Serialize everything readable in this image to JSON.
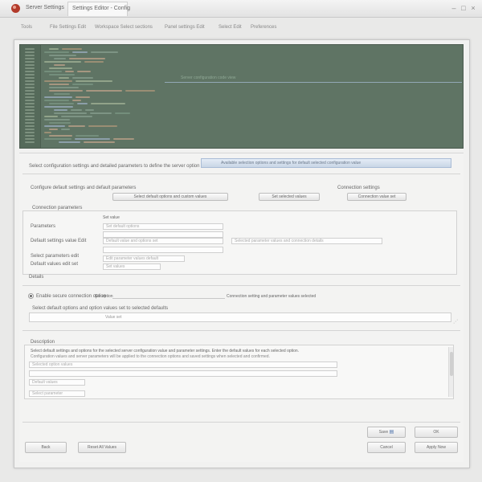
{
  "window": {
    "title": "Server Settings",
    "tab_label": "Settings Editor - Config",
    "controls": {
      "minimize": "–",
      "maximize": "□",
      "close": "×"
    }
  },
  "menu": [
    "Tools",
    "File Settings Edit",
    "Workspace Select sections",
    "Panel settings Edit",
    "Select Edit",
    "Preferences"
  ],
  "editor": {
    "header": "Server configuration code view"
  },
  "form": {
    "intro_label": "Select configuration settings and detailed parameters to define the server option",
    "highlight_value": "Available selection options and settings for default selected configuration value",
    "section1": {
      "label": "Configure default settings and default parameters",
      "button_a": "Select default options and custom values",
      "button_b": "Set selected values",
      "right_label": "Connection settings",
      "right_button": "Connection value set"
    },
    "section2": {
      "header": "Connection parameters",
      "sub_value": "Set value",
      "rows": [
        {
          "label": "Parameters",
          "value": "Set default options"
        },
        {
          "label": "Default settings value Edit",
          "value": "Default value and options set",
          "extra": "Selected parameter values and connection details"
        },
        {
          "label": "Select parameters edit",
          "value": "Edit parameter values default"
        },
        {
          "label": "Default values edit set",
          "value": "Set values"
        }
      ],
      "footer_label": "Details"
    },
    "section3": {
      "radio_label": "Enable secure connection option",
      "field_label": "Set option",
      "field_value": "Connection setting and parameter values selected",
      "sub_label": "Select default options and option values set to selected defaults",
      "sub_value": "Value set"
    },
    "section4": {
      "header": "Description",
      "text_line1": "Select default settings and options for the selected server configuration value and parameter settings. Enter the default values for each selected option.",
      "text_line2": "Configuration values and server parameters will be applied to the connection options and saved settings when selected and confirmed.",
      "fields": [
        "Selected option values",
        "Default values",
        "Select parameter"
      ]
    },
    "buttons": {
      "back": "Back",
      "reset": "Reset All Values",
      "save": "Save",
      "ok": "OK",
      "cancel": "Cancel",
      "apply": "Apply Now"
    }
  }
}
